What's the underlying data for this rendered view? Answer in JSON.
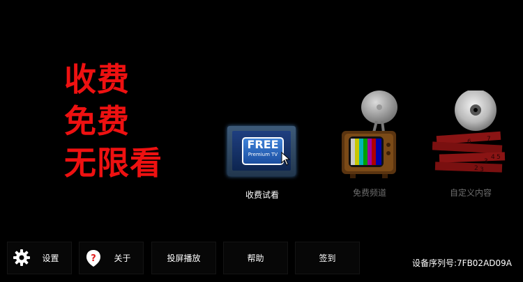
{
  "promo": {
    "lines": [
      "收费",
      "免费",
      "无限看"
    ],
    "color": "#ee1111"
  },
  "tiles": [
    {
      "label": "收费试看",
      "plate_main": "FREE",
      "plate_sub": "Premium TV"
    },
    {
      "label": "免费频道"
    },
    {
      "label": "自定义内容"
    }
  ],
  "bottom_bar": [
    {
      "label": "设置",
      "icon": "gear-icon"
    },
    {
      "label": "关于",
      "icon": "question-icon"
    },
    {
      "label": "投屏播放"
    },
    {
      "label": "帮助"
    },
    {
      "label": "签到"
    }
  ],
  "serial": "设备序列号:7FB02AD09A"
}
